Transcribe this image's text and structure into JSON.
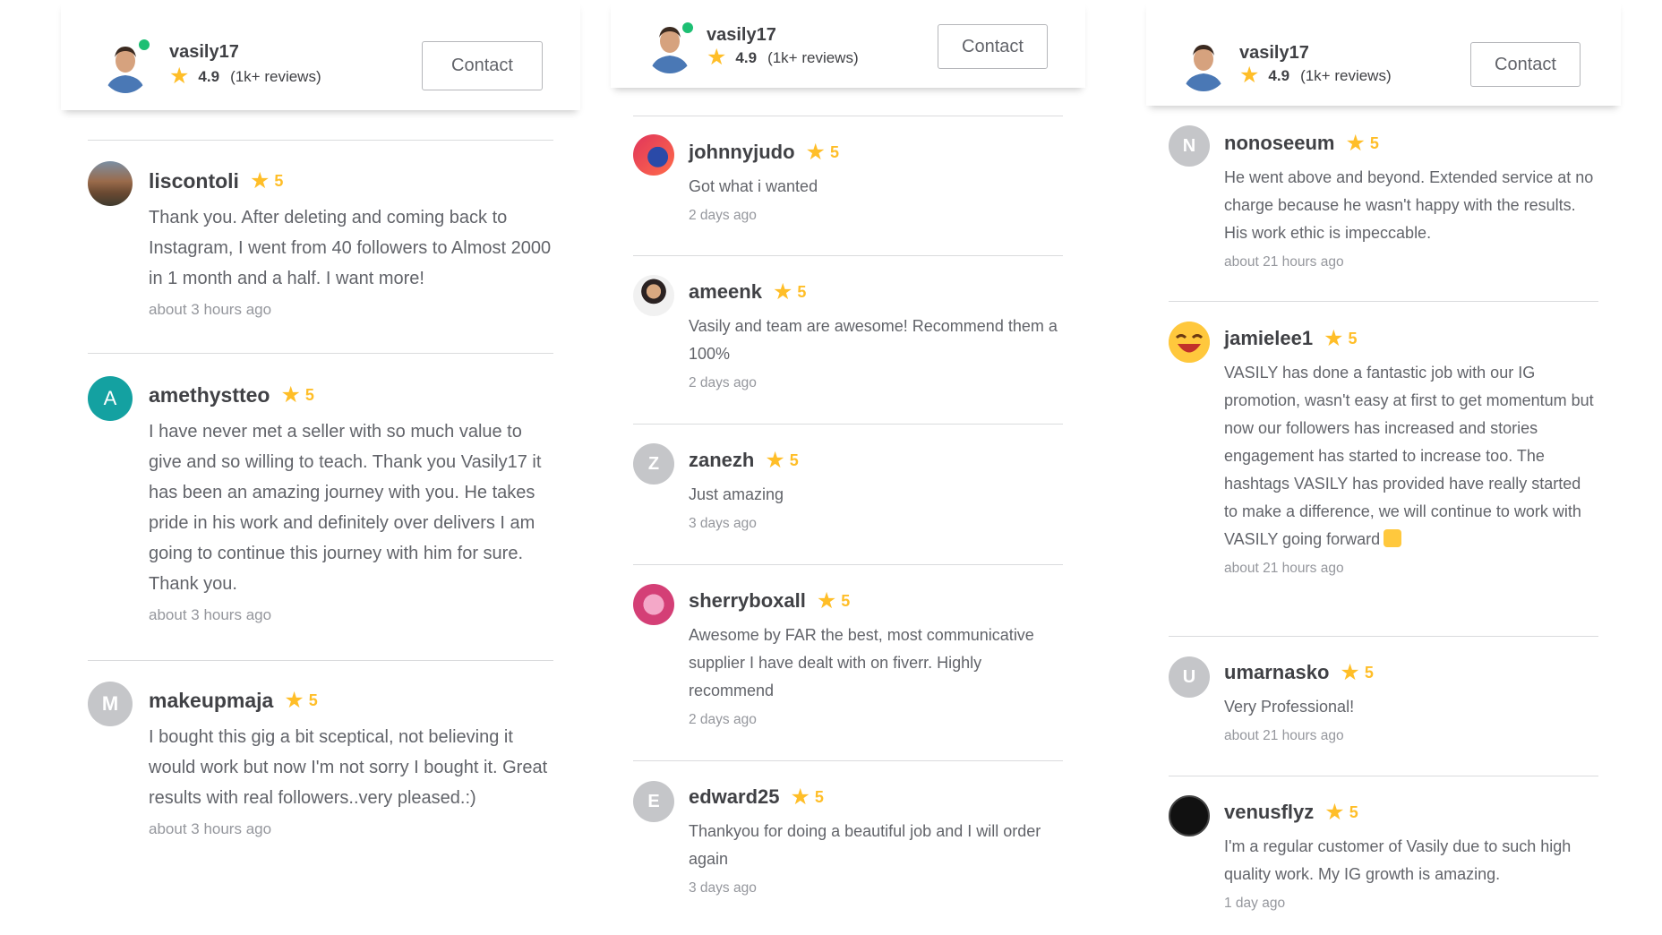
{
  "seller": {
    "name": "vasily17",
    "rating": "4.9",
    "reviews": "(1k+ reviews)",
    "contact_label": "Contact"
  },
  "columns": [
    {
      "reviews": [
        {
          "username": "liscontoli",
          "stars": "5",
          "text": "Thank you. After deleting and coming back to Instagram, I went from 40 followers to Almost 2000 in 1 month and a half. I want more!",
          "time": "about 3 hours ago",
          "avatar_letter": ""
        },
        {
          "username": "amethystteo",
          "stars": "5",
          "text": "I have never met a seller with so much value to give and so willing to teach. Thank you Vasily17 it has been an amazing journey with you. He takes pride in his work and definitely over delivers I am going to continue this journey with him for sure. Thank you.",
          "time": "about 3 hours ago",
          "avatar_letter": "A"
        },
        {
          "username": "makeupmaja",
          "stars": "5",
          "text": "I bought this gig a bit sceptical, not believing it would work but now I'm not sorry I bought it. Great results with real followers..very pleased.:)",
          "time": "about 3 hours ago",
          "avatar_letter": "M"
        }
      ]
    },
    {
      "reviews": [
        {
          "username": "johnnyjudo",
          "stars": "5",
          "text": "Got what i wanted",
          "time": "2 days ago",
          "avatar_letter": ""
        },
        {
          "username": "ameenk",
          "stars": "5",
          "text": "Vasily and team are awesome! Recommend them a 100%",
          "time": "2 days ago",
          "avatar_letter": ""
        },
        {
          "username": "zanezh",
          "stars": "5",
          "text": "Just amazing",
          "time": "3 days ago",
          "avatar_letter": "Z"
        },
        {
          "username": "sherryboxall",
          "stars": "5",
          "text": "Awesome by FAR the best, most communicative supplier I have dealt with on fiverr. Highly recommend",
          "time": "2 days ago",
          "avatar_letter": ""
        },
        {
          "username": "edward25",
          "stars": "5",
          "text": "Thankyou for doing a beautiful job and I will order again",
          "time": "3 days ago",
          "avatar_letter": "E"
        }
      ]
    },
    {
      "reviews": [
        {
          "username": "nonoseeum",
          "stars": "5",
          "text": "He went above and beyond. Extended service at no charge because he wasn't happy with the results. His work ethic is impeccable.",
          "time": "about 21 hours ago",
          "avatar_letter": "N"
        },
        {
          "username": "jamielee1",
          "stars": "5",
          "text": "VASILY has done a fantastic job with our IG promotion, wasn't easy at first to get momentum but now our followers has increased and stories engagement has started to increase too. The hashtags VASILY has provided have really started to make a difference, we will continue to work with VASILY going forward",
          "time": "about 21 hours ago",
          "avatar_letter": ""
        },
        {
          "username": "umarnasko",
          "stars": "5",
          "text": "Very Professional!",
          "time": "about 21 hours ago",
          "avatar_letter": "U"
        },
        {
          "username": "venusflyz",
          "stars": "5",
          "text": "I'm a regular customer of Vasily due to such high quality work. My IG growth is amazing.",
          "time": "1 day ago",
          "avatar_letter": ""
        }
      ]
    }
  ],
  "icons": {
    "star": "star-icon",
    "online": "online-status-icon",
    "thumbs_up": "thumbs-up-emoji"
  },
  "colors": {
    "star": "#ffbe28",
    "online": "#1dbf73",
    "teal_avatar": "#14a1a1",
    "grey_avatar": "#c5c6c9"
  }
}
